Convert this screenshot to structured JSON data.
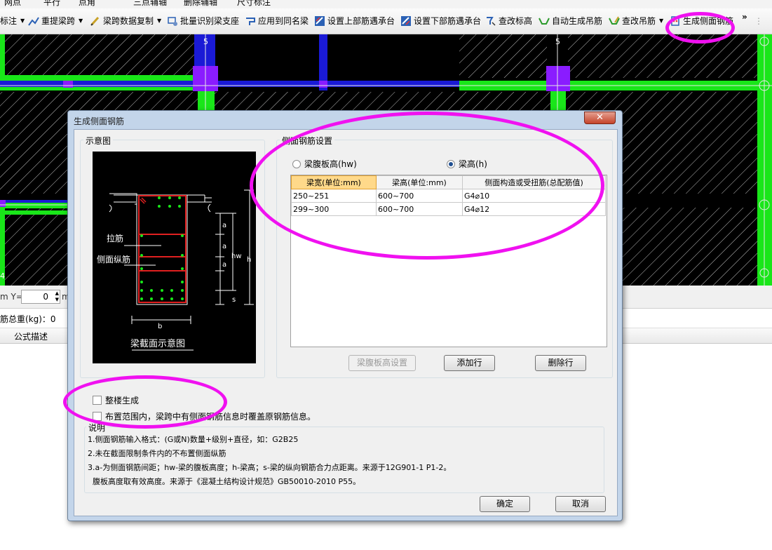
{
  "toolbar_top": [
    "网点",
    "平行",
    "点角",
    "三点辅轴",
    "删除辅轴",
    "尺寸标注"
  ],
  "toolbar": {
    "items": [
      {
        "label": "标注",
        "icon": "label-icon",
        "dropdown": true
      },
      {
        "label": "重提梁跨",
        "icon": "reextract-span-icon",
        "dropdown": true
      },
      {
        "label": "梁跨数据复制",
        "icon": "copy-span-icon",
        "dropdown": true
      },
      {
        "label": "批量识别梁支座",
        "icon": "batch-support-icon",
        "dropdown": false
      },
      {
        "label": "应用到同名梁",
        "icon": "apply-same-name-icon",
        "dropdown": false
      },
      {
        "label": "设置上部筋遇承台",
        "icon": "top-rebar-cap-icon",
        "dropdown": false
      },
      {
        "label": "设置下部筋遇承台",
        "icon": "bottom-rebar-cap-icon",
        "dropdown": false
      },
      {
        "label": "查改标高",
        "icon": "elevation-icon",
        "dropdown": false
      },
      {
        "label": "自动生成吊筋",
        "icon": "auto-hanger-icon",
        "dropdown": false
      },
      {
        "label": "查改吊筋",
        "icon": "edit-hanger-icon",
        "dropdown": true
      },
      {
        "label": "生成侧面钢筋",
        "icon": "side-rebar-icon",
        "dropdown": false
      }
    ],
    "overflow": "»"
  },
  "canvas": {
    "axis_labels": [
      "5",
      "5",
      "4"
    ]
  },
  "coord_bar": {
    "y_label": "m Y=",
    "y_value": "0",
    "unit": "m"
  },
  "steel_total": {
    "label": "筋总重(kg)：0"
  },
  "formula_header": {
    "label": "公式描述"
  },
  "dialog": {
    "title": "生成侧面钢筋",
    "close": "✕",
    "diagram_group_title": "示意图",
    "diagram": {
      "tie_label": "拉筋",
      "side_bar_label": "侧面纵筋",
      "caption": "梁截面示意图",
      "dim_a": "a",
      "dim_hw": "hw",
      "dim_h": "h",
      "dim_s": "s",
      "dim_b": "b"
    },
    "settings_group_title": "侧面钢筋设置",
    "radio_hw": "梁腹板高(hw)",
    "radio_h": "梁高(h)",
    "radio_selected": "h",
    "table": {
      "headers": [
        "梁宽(单位:mm)",
        "梁高(单位:mm)",
        "侧面构造或受扭筋(总配筋值)"
      ],
      "rows": [
        [
          "250~251",
          "600~700",
          "G4⌀10"
        ],
        [
          "299~300",
          "600~700",
          "G4⌀12"
        ]
      ]
    },
    "btn_web_height": "梁腹板高设置",
    "btn_add_row": "添加行",
    "btn_delete_row": "删除行",
    "chk_whole_building": "整楼生成",
    "chk_overwrite": "布置范围内，梁跨中有侧面钢筋信息时覆盖原钢筋信息。",
    "notes_title": "说明",
    "notes": [
      "1.侧面钢筋输入格式：(G或N)数量+级别+直径，如：G2B25",
      "2.未在截面限制条件内的不布置侧面纵筋",
      "3.a-为侧面钢筋间距；hw-梁的腹板高度；h-梁高；s-梁的纵向钢筋合力点距离。来源于12G901-1 P1-2。",
      "  腹板高度取有效高度。来源于《混凝土结构设计规范》GB50010-2010 P55。"
    ],
    "ok": "确定",
    "cancel": "取消"
  },
  "colors": {
    "highlight": "#f011f0",
    "beam_green": "#19e619",
    "beam_blue": "#1a1ad6",
    "column_purple": "#8a1cff"
  }
}
